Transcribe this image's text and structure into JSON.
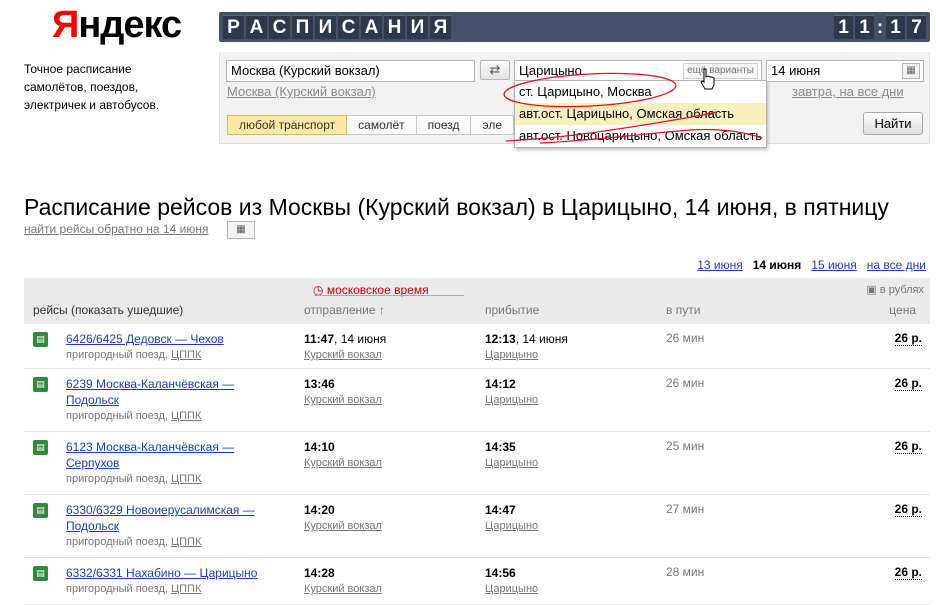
{
  "logo": {
    "first": "Я",
    "rest": "ндекс"
  },
  "tagline": "Точное расписание самолётов, поездов, электричек и автобусов.",
  "board": {
    "title_letters": [
      "Р",
      "А",
      "С",
      "П",
      "И",
      "С",
      "А",
      "Н",
      "И",
      "Я"
    ],
    "clock_h": [
      "1",
      "1"
    ],
    "clock_m": [
      "1",
      "7"
    ]
  },
  "form": {
    "from_value": "Москва (Курский вокзал)",
    "from_hint": "Москва (Курский вокзал)",
    "swap_icon": "⇄",
    "to_value": "Царицыно",
    "to_more": "ещё варианты",
    "date_value": "14 июня",
    "date_hint": "завтра, на все дни",
    "tabs": [
      "любой транспорт",
      "самолёт",
      "поезд",
      "эле"
    ],
    "find": "Найти"
  },
  "suggest": [
    "ст. Царицыно, Москва",
    "авт.ост. Царицыно, Омская область",
    "авт.ост. Новоцарицыно, Омская область"
  ],
  "heading": "Расписание рейсов из Москвы (Курский вокзал) в Царицыно, 14 июня, в пятницу",
  "back_link": "найти рейсы обратно на 14 июня",
  "days": {
    "prev": "13 июня",
    "current": "14 июня",
    "next": "15 июня",
    "all": "на все дни"
  },
  "table": {
    "moscow_time": "московское время",
    "col_trips": "рейсы",
    "col_trips_hint": "(показать ушедшие)",
    "col_dep": "отправление ↑",
    "col_arr": "прибытие",
    "col_dur": "в пути",
    "col_price": "цена",
    "currency": "в рублях",
    "rows": [
      {
        "name": "6426/6425 Дедовск  — Чехов",
        "type": "пригородный поезд,",
        "carrier": "ЦППК",
        "dep": "11:47",
        "dep_date": ", 14 июня",
        "dep_st": "Курский вокзал",
        "arr": "12:13",
        "arr_date": ", 14 июня",
        "arr_st": "Царицыно",
        "dur": "26 мин",
        "price": "26 р."
      },
      {
        "name": "6239 Москва-Каланчёвская  — Подольск",
        "type": "пригородный поезд,",
        "carrier": "ЦППК",
        "dep": "13:46",
        "dep_date": "",
        "dep_st": "Курский вокзал",
        "arr": "14:12",
        "arr_date": "",
        "arr_st": "Царицыно",
        "dur": "26 мин",
        "price": "26 р."
      },
      {
        "name": "6123 Москва-Каланчёвская  — Серпухов",
        "type": "пригородный поезд,",
        "carrier": "ЦППК",
        "dep": "14:10",
        "dep_date": "",
        "dep_st": "Курский вокзал",
        "arr": "14:35",
        "arr_date": "",
        "arr_st": "Царицыно",
        "dur": "25 мин",
        "price": "26 р."
      },
      {
        "name": "6330/6329 Новоиерусалимская  — Подольск",
        "type": "пригородный поезд,",
        "carrier": "ЦППК",
        "dep": "14:20",
        "dep_date": "",
        "dep_st": "Курский вокзал",
        "arr": "14:47",
        "arr_date": "",
        "arr_st": "Царицыно",
        "dur": "27 мин",
        "price": "26 р."
      },
      {
        "name": "6332/6331 Нахабино  — Царицыно",
        "type": "пригородный поезд,",
        "carrier": "ЦППК",
        "dep": "14:28",
        "dep_date": "",
        "dep_st": "Курский вокзал",
        "arr": "14:56",
        "arr_date": "",
        "arr_st": "Царицыно",
        "dur": "28 мин",
        "price": "26 р."
      }
    ]
  }
}
